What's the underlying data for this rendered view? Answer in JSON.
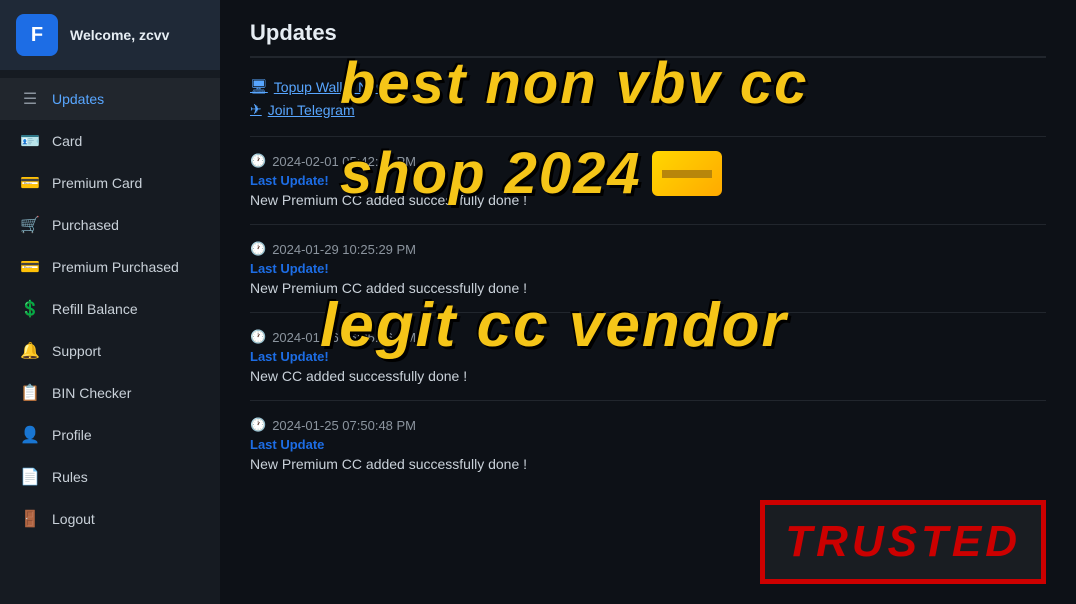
{
  "sidebar": {
    "header": {
      "welcome_text": "Welcome,",
      "username": "zcvv"
    },
    "nav_items": [
      {
        "id": "updates",
        "label": "Updates",
        "icon": "☰",
        "active": true
      },
      {
        "id": "card",
        "label": "Card",
        "icon": "🪪"
      },
      {
        "id": "premium-card",
        "label": "Premium Card",
        "icon": "💳"
      },
      {
        "id": "purchased",
        "label": "Purchased",
        "icon": "🛒"
      },
      {
        "id": "premium-purchased",
        "label": "Premium Purchased",
        "icon": "💳"
      },
      {
        "id": "refill-balance",
        "label": "Refill Balance",
        "icon": "💲"
      },
      {
        "id": "support",
        "label": "Support",
        "icon": "🔔"
      },
      {
        "id": "bin-checker",
        "label": "BIN Checker",
        "icon": "📋"
      },
      {
        "id": "profile",
        "label": "Profile",
        "icon": "👤"
      },
      {
        "id": "rules",
        "label": "Rules",
        "icon": "📄"
      },
      {
        "id": "logout",
        "label": "Logout",
        "icon": "🚪"
      }
    ]
  },
  "main": {
    "title": "Updates",
    "top_links": [
      {
        "icon": "🖥",
        "label": "Topup Wallet Now"
      },
      {
        "icon": "✈",
        "label": "Join Telegram"
      }
    ],
    "updates": [
      {
        "time": "2024-02-01 05:42:40 PM",
        "label": "Last Update!",
        "text": "New Premium CC added successfully done !"
      },
      {
        "time": "2024-01-29 10:25:29 PM",
        "label": "Last Update!",
        "text": "New Premium CC added successfully done !"
      },
      {
        "time": "2024-01-26 06:05:56 PM",
        "label": "Last Update!",
        "text": "New CC added successfully done !"
      },
      {
        "time": "2024-01-25 07:50:48 PM",
        "label": "Last Update",
        "text": "New Premium CC added successfully done !"
      }
    ]
  },
  "overlay": {
    "line1": "best non vbv cc",
    "line2": "shop 2024",
    "line3": "legit cc vendor",
    "trusted": "TRUSTED"
  }
}
